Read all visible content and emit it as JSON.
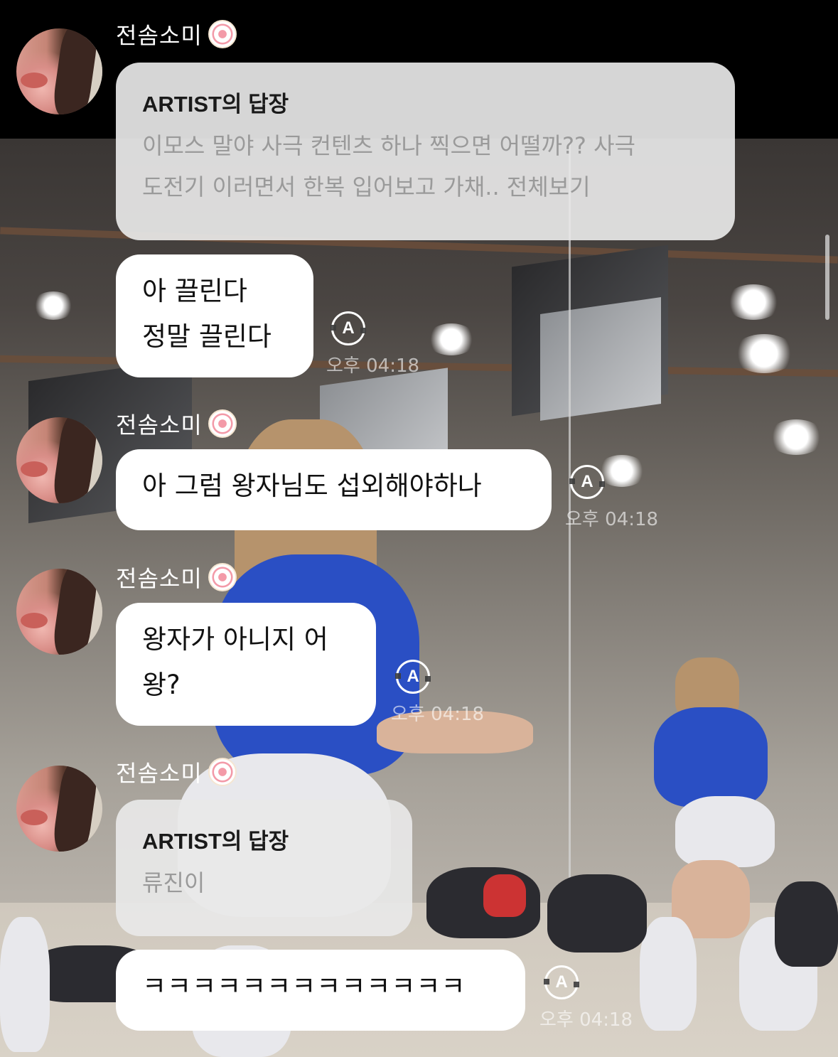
{
  "messages": [
    {
      "sender": "전솜소미",
      "reply": {
        "title": "ARTIST의 답장",
        "body_line1": "이모스 말야 사극 컨텐츠 하나 찍으면 어떨까?? 사극",
        "body_line2": "도전기 이러면서 한복 입어보고 가채.. 전체보기"
      },
      "text_line1": "아 끌린다",
      "text_line2": "정말 끌린다",
      "time": "오후 04:18"
    },
    {
      "sender": "전솜소미",
      "text_line1": "아 그럼 왕자님도 섭외해야하나",
      "time": "오후 04:18"
    },
    {
      "sender": "전솜소미",
      "text_line1": "왕자가 아니지 어",
      "text_line2": "왕?",
      "time": "오후 04:18"
    },
    {
      "sender": "전솜소미",
      "reply": {
        "title": "ARTIST의 답장",
        "body_line1": "류진이"
      },
      "text_line1": "ㅋㅋㅋㅋㅋㅋㅋㅋㅋㅋㅋㅋㅋ",
      "time": "오후 04:18"
    }
  ],
  "icons": {
    "refresh": "translate-refresh-icon",
    "refresh_glyph": "A",
    "badge": "membership-badge-icon"
  }
}
